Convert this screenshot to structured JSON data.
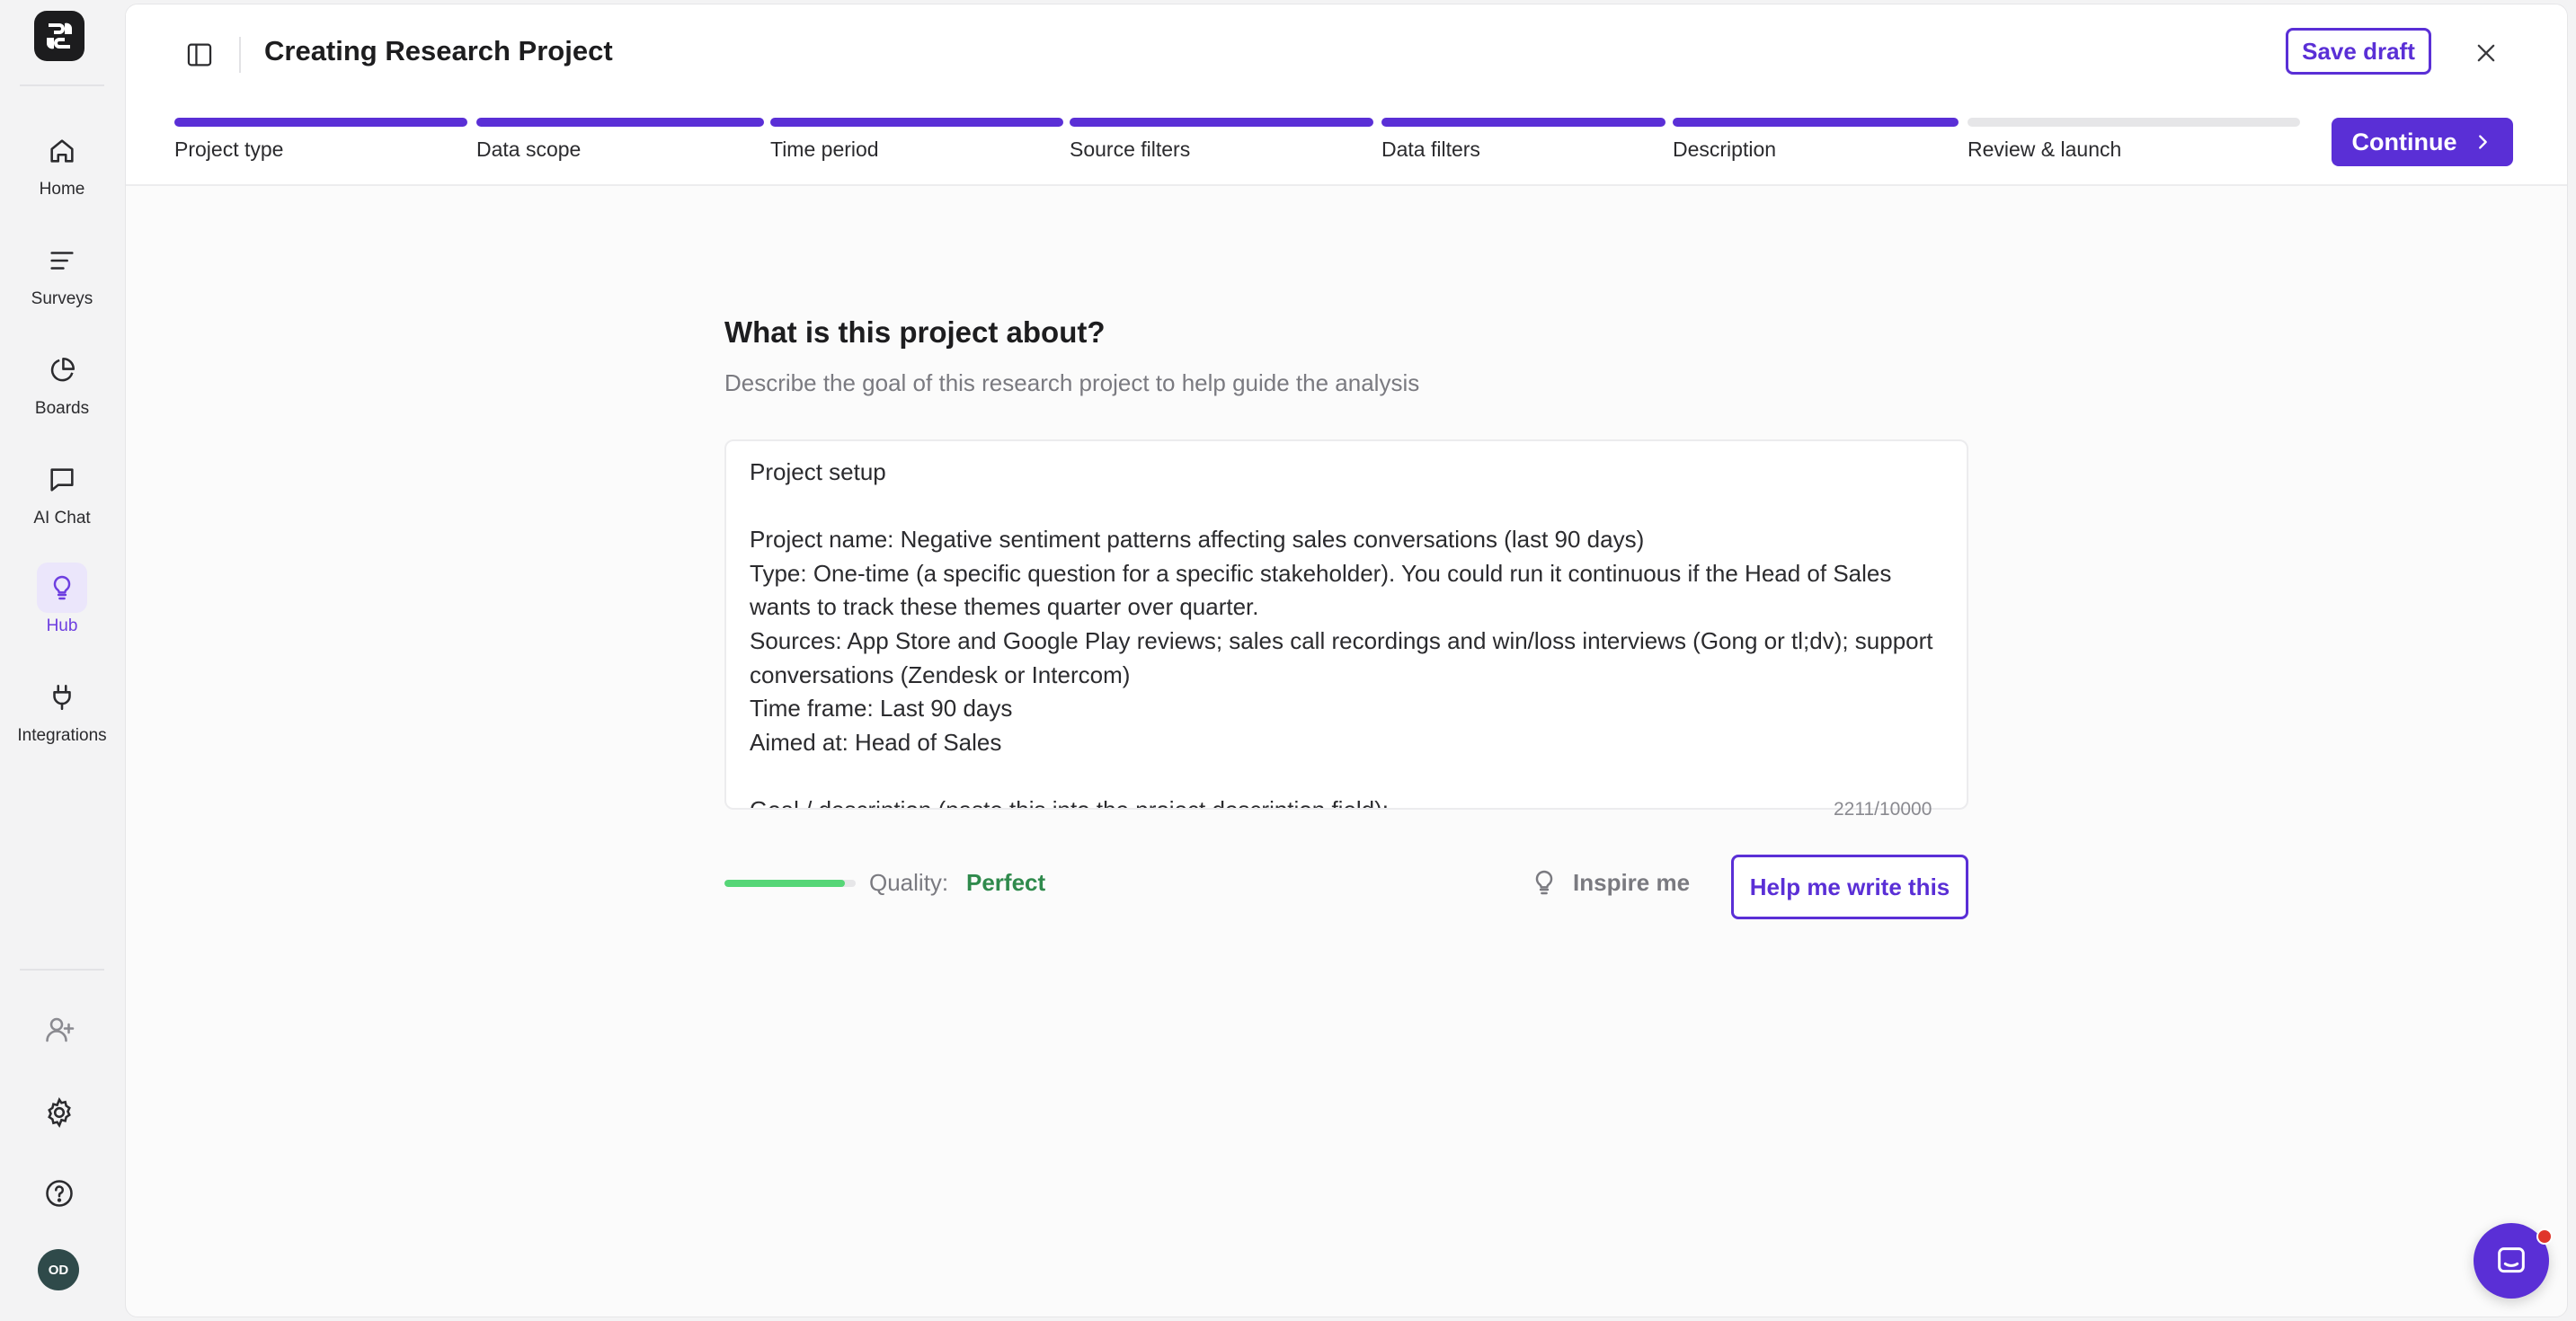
{
  "app": {
    "page_title": "Creating Research Project",
    "save_draft_label": "Save draft",
    "continue_label": "Continue"
  },
  "sidebar": {
    "items": [
      {
        "label": "Home",
        "icon": "home-icon"
      },
      {
        "label": "Surveys",
        "icon": "list-icon"
      },
      {
        "label": "Boards",
        "icon": "pie-chart-icon"
      },
      {
        "label": "AI Chat",
        "icon": "chat-bubble-icon"
      },
      {
        "label": "Hub",
        "icon": "lightbulb-icon",
        "active": true
      },
      {
        "label": "Integrations",
        "icon": "plug-icon"
      }
    ],
    "avatar_initials": "OD",
    "bottom_icons": [
      "add-user-icon",
      "gear-icon",
      "help-icon"
    ]
  },
  "steps": [
    {
      "label": "Project type",
      "done": true
    },
    {
      "label": "Data scope",
      "done": true
    },
    {
      "label": "Time period",
      "done": true
    },
    {
      "label": "Source filters",
      "done": true
    },
    {
      "label": "Data filters",
      "done": true
    },
    {
      "label": "Description",
      "done": true
    },
    {
      "label": "Review & launch",
      "done": false
    }
  ],
  "form": {
    "question": "What is this project about?",
    "subtitle": "Describe the goal of this research project to help guide the analysis",
    "description_text": "Project setup\n\nProject name: Negative sentiment patterns affecting sales conversations (last 90 days)\nType: One-time (a specific question for a specific stakeholder). You could run it continuous if the Head of Sales wants to track these themes quarter over quarter.\nSources: App Store and Google Play reviews; sales call recordings and win/loss interviews (Gong or tl;dv); support conversations (Zendesk or Intercom)\nTime frame: Last 90 days\nAimed at: Head of Sales\n\nGoal / description (paste this into the project description field):",
    "char_count": "2211/10000",
    "quality_label": "Quality:",
    "quality_value": "Perfect",
    "quality_level_fraction": 0.92,
    "inspire_label": "Inspire me",
    "help_label": "Help me write this"
  },
  "colors": {
    "accent": "#5a2fd6",
    "quality_green": "#56d677",
    "quality_text": "#2f8a4c",
    "notification": "#e0352b"
  }
}
